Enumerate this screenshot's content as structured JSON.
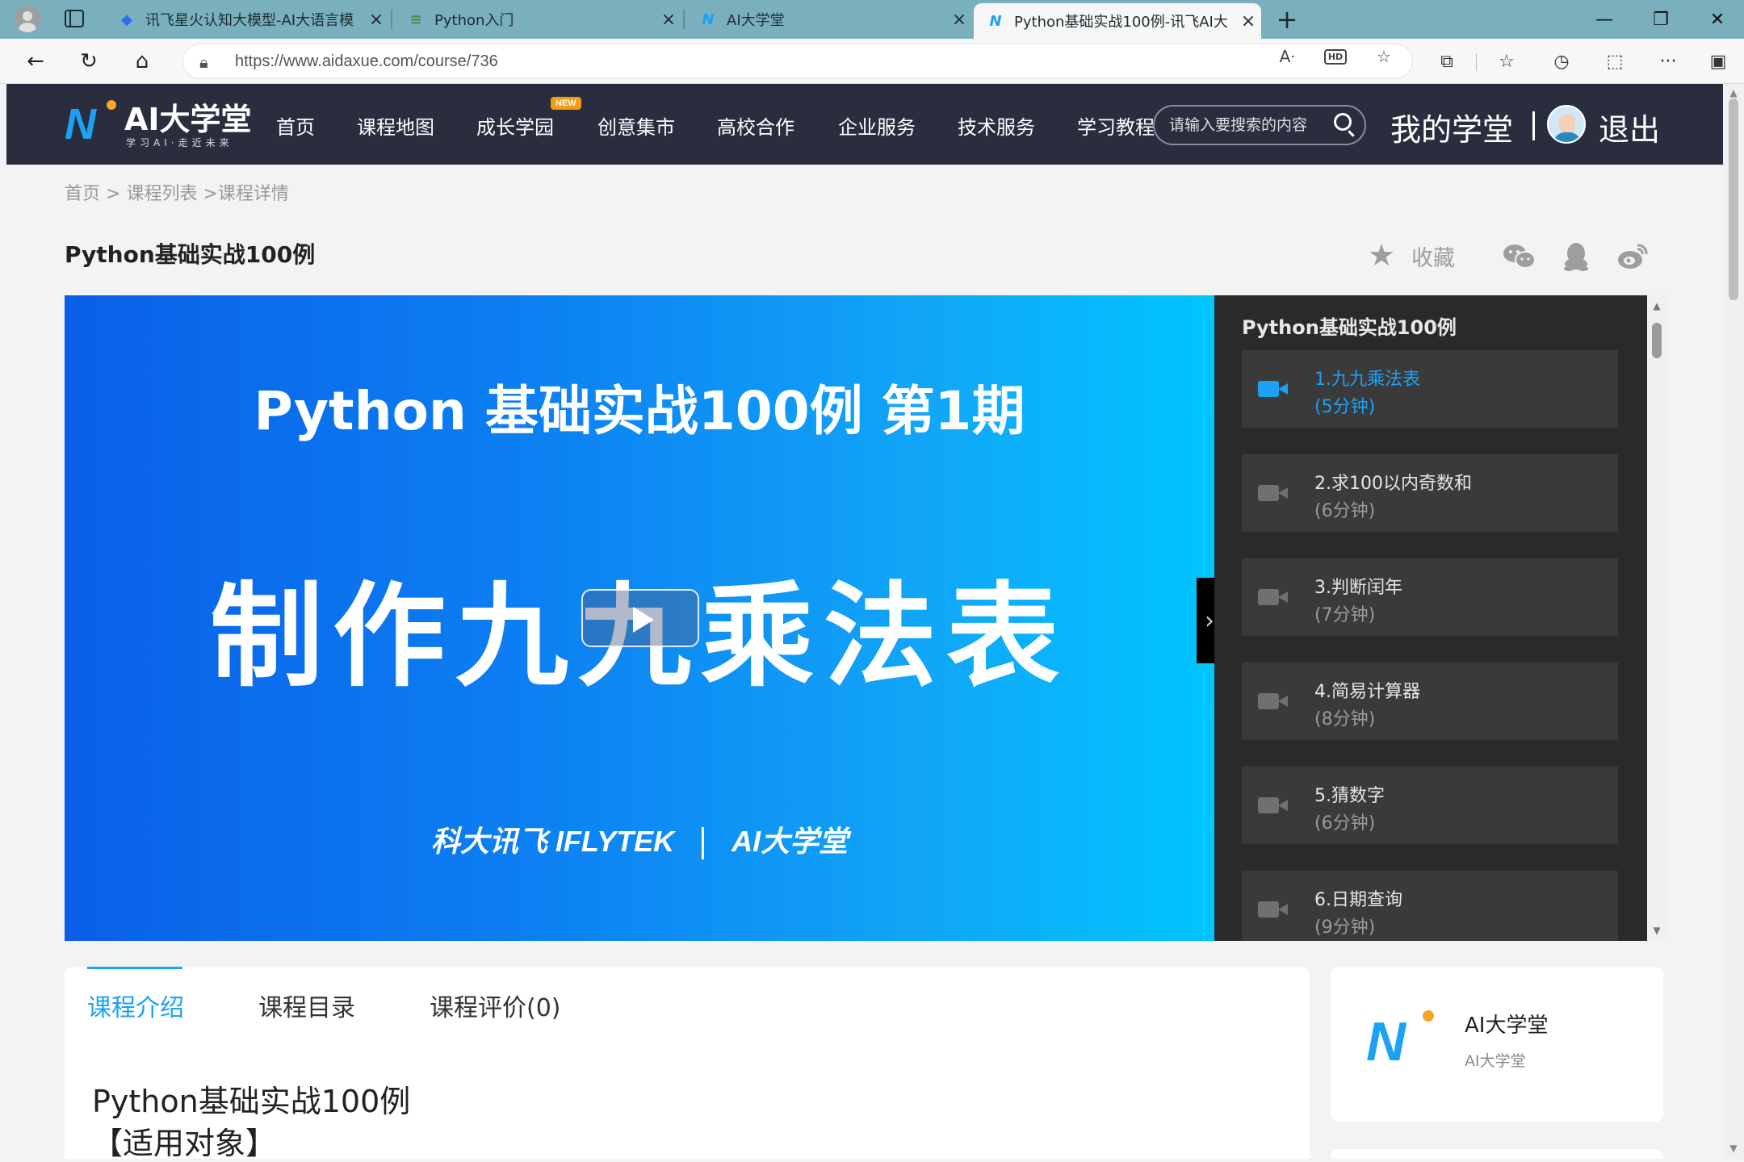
{
  "browser": {
    "tabs": [
      {
        "title": "讯飞星火认知大模型-AI大语言模"
      },
      {
        "title": "Python入门"
      },
      {
        "title": "AI大学堂"
      },
      {
        "title": "Python基础实战100例-讯飞AI大"
      }
    ],
    "url": "https://www.aidaxue.com/course/736"
  },
  "header": {
    "logo_text": "AI大学堂",
    "logo_slogan": "学习AI·走近未来",
    "nav": [
      "首页",
      "课程地图",
      "成长学园",
      "创意集市",
      "高校合作",
      "企业服务",
      "技术服务",
      "学习教程"
    ],
    "new_badge": "NEW",
    "search_placeholder": "请输入要搜索的内容",
    "my_study": "我的学堂",
    "logout": "退出"
  },
  "breadcrumb": {
    "home": "首页",
    "list": "课程列表",
    "detail": "课程详情",
    "sep": ">"
  },
  "course": {
    "title": "Python基础实战100例",
    "favorite": "收藏"
  },
  "video": {
    "subtitle": "Python 基础实战100例 第1期",
    "main_title": "制作九九乘法表",
    "logo_left": "科大讯飞 IFLYTEK",
    "logo_right": "AI大学堂"
  },
  "playlist": {
    "title": "Python基础实战100例",
    "items": [
      {
        "name": "1.九九乘法表",
        "duration": "(5分钟)"
      },
      {
        "name": "2.求100以内奇数和",
        "duration": "(6分钟)"
      },
      {
        "name": "3.判断闰年",
        "duration": "(7分钟)"
      },
      {
        "name": "4.简易计算器",
        "duration": "(8分钟)"
      },
      {
        "name": "5.猜数字",
        "duration": "(6分钟)"
      },
      {
        "name": "6.日期查询",
        "duration": "(9分钟)"
      }
    ]
  },
  "content_tabs": [
    "课程介绍",
    "课程目录",
    "课程评价(0)"
  ],
  "intro": {
    "heading": "Python基础实战100例",
    "section": "【适用对象】"
  },
  "author": {
    "name": "AI大学堂",
    "sub": "AI大学堂"
  },
  "colors": {
    "accent": "#1ba2f5",
    "header_bg": "#292d3e",
    "tabbar_bg": "#7ab0be"
  }
}
